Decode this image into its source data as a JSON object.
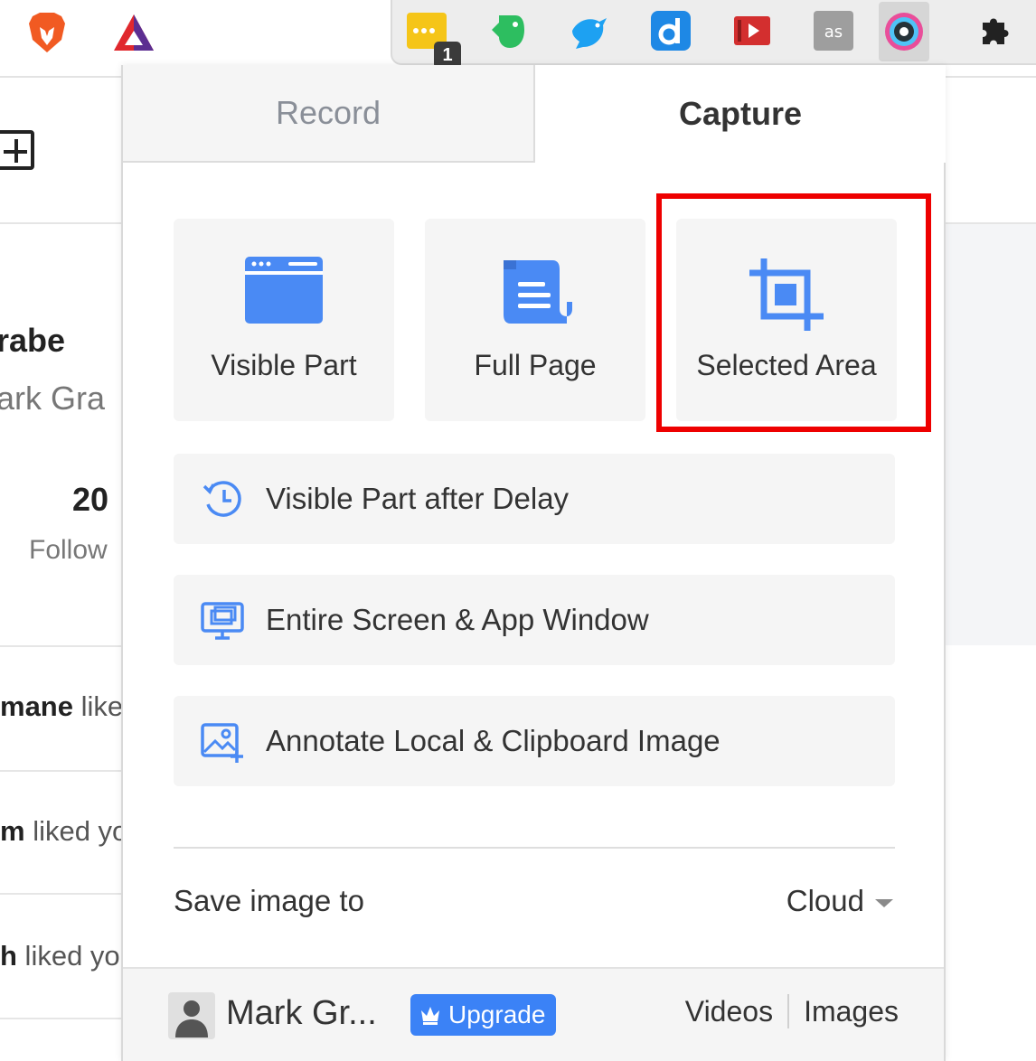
{
  "browser": {
    "toolbar_icons": [
      "brave-lion-icon",
      "triangle-logo-icon"
    ],
    "extensions": [
      {
        "name": "yellow-dots-extension-icon",
        "badge": "1"
      },
      {
        "name": "evernote-elephant-icon"
      },
      {
        "name": "tweeten-bird-icon"
      },
      {
        "name": "dictionary-d-icon"
      },
      {
        "name": "red-video-extension-icon"
      },
      {
        "name": "lastfm-icon"
      },
      {
        "name": "awesome-screenshot-icon",
        "active": true
      },
      {
        "name": "puzzle-extensions-icon"
      }
    ]
  },
  "background_page": {
    "name_fragment": "rabe",
    "subtitle_fragment": "ark Gra",
    "count": "20",
    "count_label_fragment": "Follow",
    "activity": [
      {
        "bold": "mane",
        "text": " like"
      },
      {
        "bold": "m",
        "text": " liked yo"
      },
      {
        "bold": "h",
        "text": " liked yo"
      }
    ]
  },
  "popup": {
    "tabs": {
      "record": "Record",
      "capture": "Capture"
    },
    "tiles": {
      "visible_part": "Visible Part",
      "full_page": "Full Page",
      "selected_area": "Selected Area"
    },
    "rows": {
      "delay": "Visible Part after Delay",
      "entire_screen": "Entire Screen & App Window",
      "annotate": "Annotate Local & Clipboard Image"
    },
    "save": {
      "label": "Save image to",
      "destination": "Cloud"
    },
    "footer": {
      "username": "Mark Gr...",
      "upgrade": "Upgrade",
      "videos": "Videos",
      "images": "Images"
    }
  },
  "colors": {
    "accent_blue": "#4a8af4",
    "highlight_red": "#ee0000",
    "upgrade_blue": "#3b82f6"
  }
}
